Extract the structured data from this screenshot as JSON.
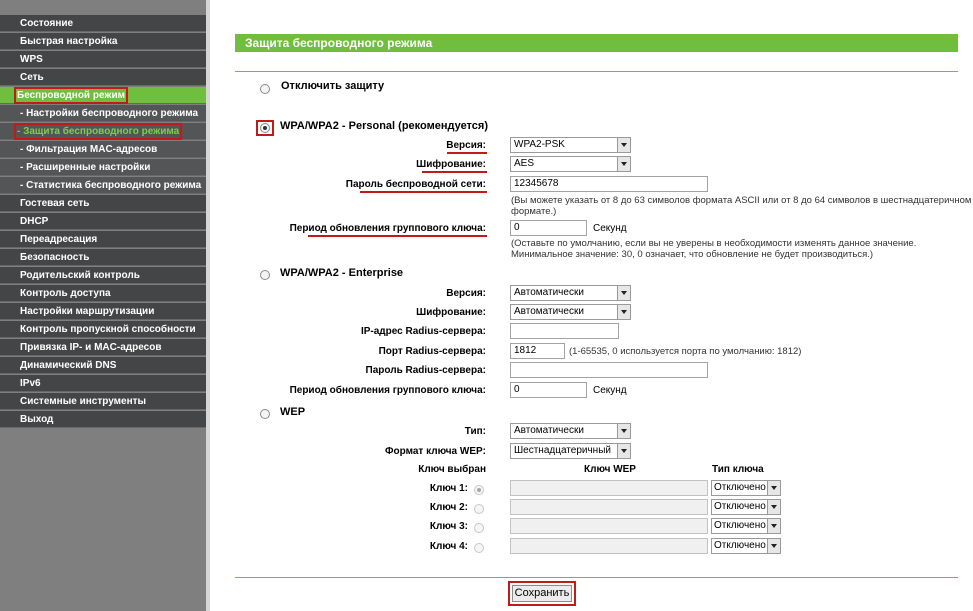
{
  "sidebar": {
    "items": [
      {
        "label": "Состояние"
      },
      {
        "label": "Быстрая настройка"
      },
      {
        "label": "WPS"
      },
      {
        "label": "Сеть"
      },
      {
        "label": "Беспроводной режим"
      },
      {
        "label": "- Настройки беспроводного режима"
      },
      {
        "label": "- Защита беспроводного режима"
      },
      {
        "label": "- Фильтрация MAC-адресов"
      },
      {
        "label": "- Расширенные настройки"
      },
      {
        "label": "- Статистика беспроводного режима"
      },
      {
        "label": "Гостевая сеть"
      },
      {
        "label": "DHCP"
      },
      {
        "label": "Переадресация"
      },
      {
        "label": "Безопасность"
      },
      {
        "label": "Родительский контроль"
      },
      {
        "label": "Контроль доступа"
      },
      {
        "label": "Настройки маршрутизации"
      },
      {
        "label": "Контроль пропускной способности"
      },
      {
        "label": "Привязка IP- и MAC-адресов"
      },
      {
        "label": "Динамический DNS"
      },
      {
        "label": "IPv6"
      },
      {
        "label": "Системные инструменты"
      },
      {
        "label": "Выход"
      }
    ]
  },
  "page": {
    "title": "Защита беспроводного режима"
  },
  "disable": {
    "label": "Отключить защиту",
    "checked": false
  },
  "personal": {
    "label": "WPA/WPA2 - Personal (рекомендуется)",
    "checked": true,
    "version_label": "Версия:",
    "version_value": "WPA2-PSK",
    "encryption_label": "Шифрование:",
    "encryption_value": "AES",
    "password_label": "Пароль беспроводной сети:",
    "password_value": "12345678",
    "password_help_1": "(Вы можете указать от 8 до 63 символов формата ASCII или от 8 до 64 символов в шестнадцатеричном",
    "password_help_2": "формате.)",
    "period_label": "Период обновления группового ключа:",
    "period_value": "0",
    "period_unit": "Секунд",
    "period_help_1": "(Оставьте по умолчанию, если вы не уверены в необходимости изменять данное значение.",
    "period_help_2": "Минимальное значение: 30, 0 означает, что обновление не будет производиться.)"
  },
  "enterprise": {
    "label": "WPA/WPA2 - Enterprise",
    "checked": false,
    "version_label": "Версия:",
    "version_value": "Автоматически",
    "encryption_label": "Шифрование:",
    "encryption_value": "Автоматически",
    "radius_ip_label": "IP-адрес Radius-сервера:",
    "radius_ip_value": "",
    "radius_port_label": "Порт Radius-сервера:",
    "radius_port_value": "1812",
    "radius_port_help": "(1-65535, 0 используется порта по умолчанию: 1812)",
    "radius_password_label": "Пароль Radius-сервера:",
    "radius_password_value": "",
    "period_label": "Период обновления группового ключа:",
    "period_value": "0",
    "period_unit": "Секунд"
  },
  "wep": {
    "label": "WEP",
    "checked": false,
    "type_label": "Тип:",
    "type_value": "Автоматически",
    "format_label": "Формат ключа WEP:",
    "format_value": "Шестнадцатеричный",
    "col_selected": "Ключ выбран",
    "col_key": "Ключ WEP",
    "col_type": "Тип ключа",
    "keys": [
      {
        "label": "Ключ 1:",
        "selected": true,
        "value": "",
        "type": "Отключено"
      },
      {
        "label": "Ключ 2:",
        "selected": false,
        "value": "",
        "type": "Отключено"
      },
      {
        "label": "Ключ 3:",
        "selected": false,
        "value": "",
        "type": "Отключено"
      },
      {
        "label": "Ключ 4:",
        "selected": false,
        "value": "",
        "type": "Отключено"
      }
    ]
  },
  "save_label": "Сохранить",
  "colors": {
    "accent": "#6fbe3d",
    "highlight": "#c11a1a",
    "sidebar": "#444546"
  }
}
